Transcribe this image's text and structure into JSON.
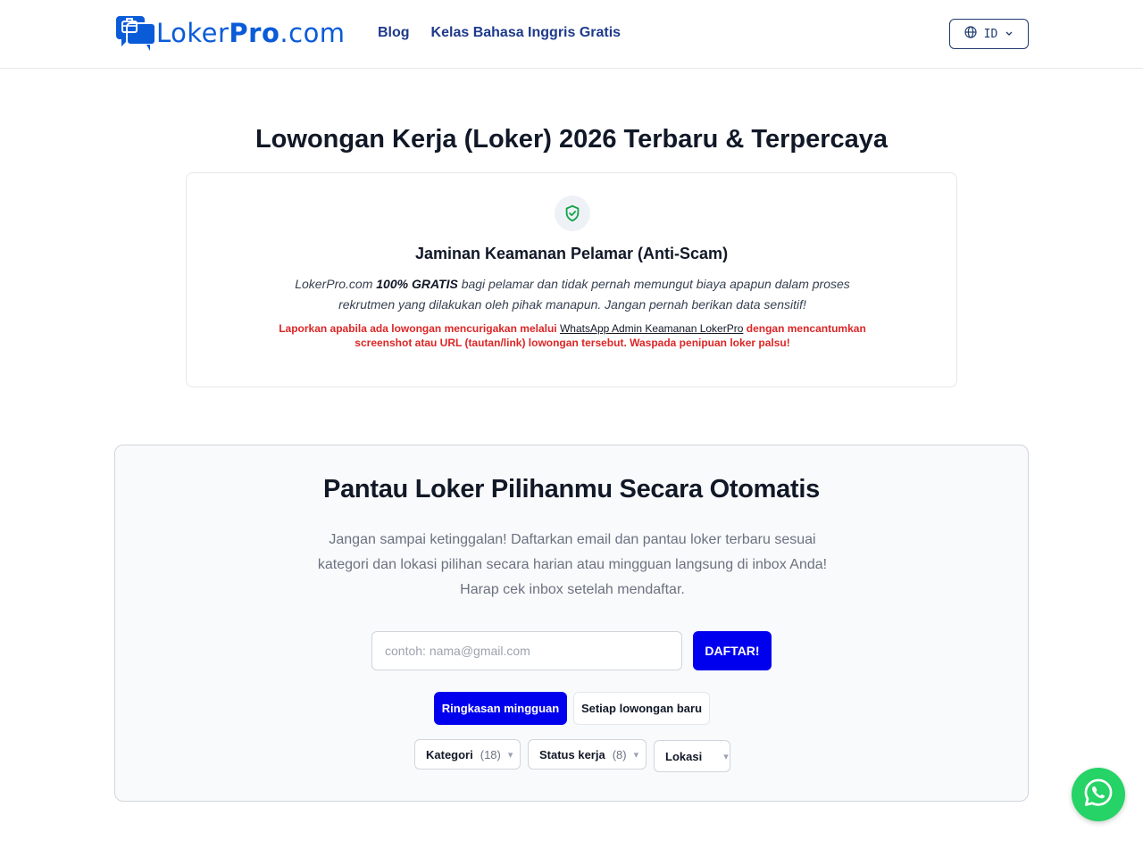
{
  "header": {
    "logo": {
      "part1": "Loker",
      "part2": "Pro",
      "part3": ".com"
    },
    "nav": [
      {
        "label": "Blog"
      },
      {
        "label": "Kelas Bahasa Inggris Gratis"
      }
    ],
    "language": {
      "code": "ID"
    }
  },
  "page_title": "Lowongan Kerja (Loker) 2026 Terbaru & Terpercaya",
  "safety": {
    "title": "Jaminan Keamanan Pelamar (Anti-Scam)",
    "desc_prefix": "LokerPro.com ",
    "desc_bold": "100% GRATIS",
    "desc_suffix": " bagi pelamar dan tidak pernah memungut biaya apapun dalam proses rekrutmen yang dilakukan oleh pihak manapun. Jangan pernah berikan data sensitif!",
    "warn_prefix": "Laporkan apabila ada lowongan mencurigakan melalui ",
    "warn_link": "WhatsApp Admin Keamanan LokerPro",
    "warn_suffix": " dengan mencantumkan screenshot atau URL (tautan/link) lowongan tersebut. Waspada penipuan loker palsu!"
  },
  "subscribe": {
    "title": "Pantau Loker Pilihanmu Secara Otomatis",
    "desc": "Jangan sampai ketinggalan! Daftarkan email dan pantau loker terbaru sesuai kategori dan lokasi pilihan secara harian atau mingguan langsung di inbox Anda! Harap cek inbox setelah mendaftar.",
    "email_placeholder": "contoh: nama@gmail.com",
    "submit_label": "DAFTAR!",
    "frequency": [
      {
        "label": "Ringkasan mingguan",
        "active": true
      },
      {
        "label": "Setiap lowongan baru",
        "active": false
      }
    ],
    "filters": [
      {
        "label": "Kategori",
        "count": "(18)"
      },
      {
        "label": "Status kerja",
        "count": "(8)"
      },
      {
        "label": "Lokasi",
        "count": ""
      }
    ]
  },
  "colors": {
    "brand_blue": "#0a5bd8",
    "primary_button": "#0000ee",
    "warning_red": "#dc2626",
    "whatsapp_green": "#25d366",
    "shield_green": "#16a34a"
  },
  "icons": {
    "logo": "briefcase-chat-icon",
    "language": "globe-icon",
    "safety": "shield-check-icon",
    "dropdown": "chevron-down-icon",
    "whatsapp": "whatsapp-icon"
  }
}
